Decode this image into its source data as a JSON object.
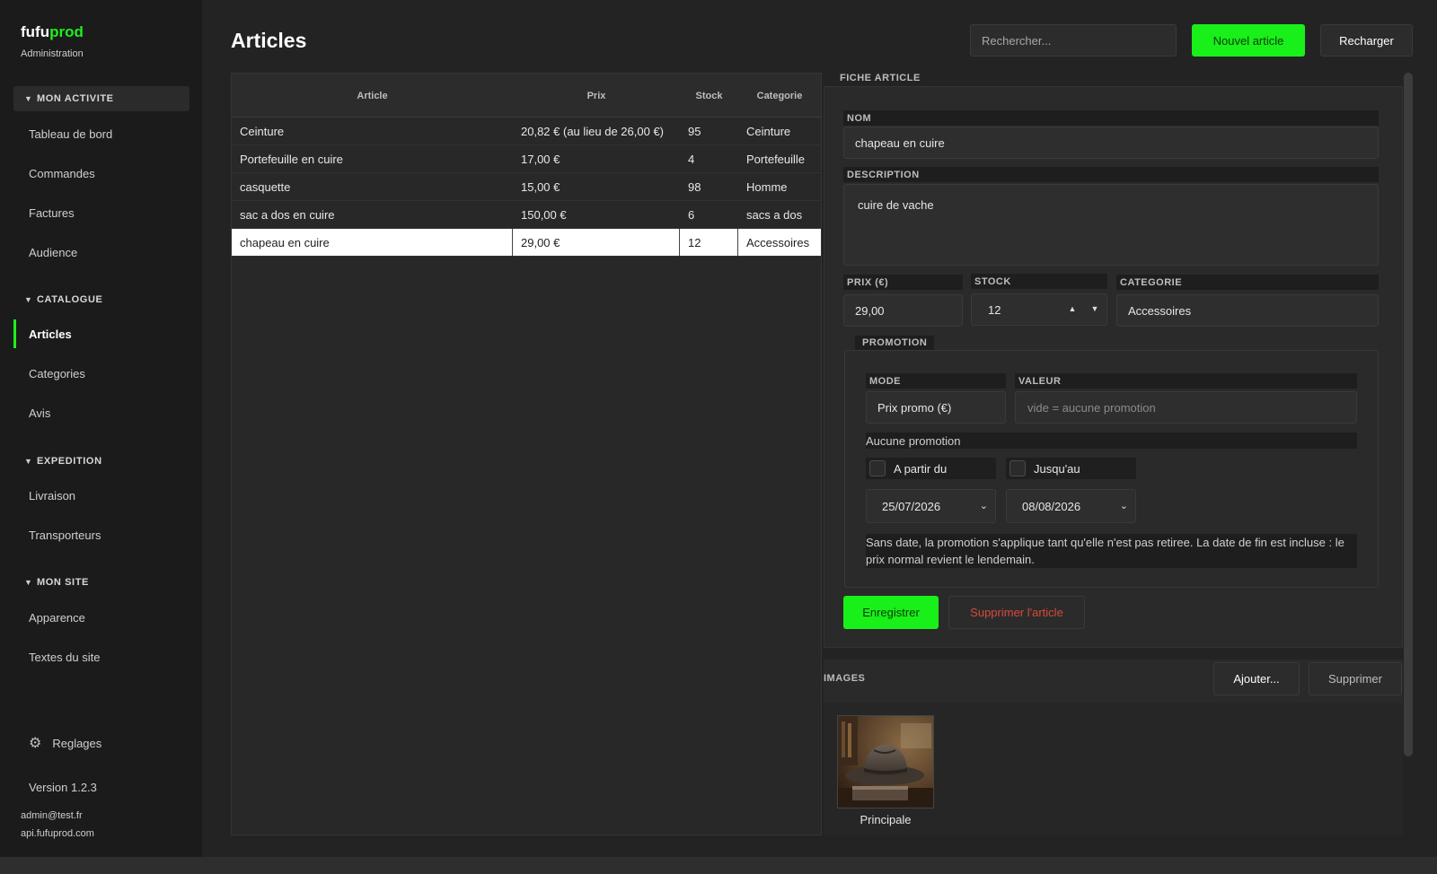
{
  "sidebar": {
    "brand_a": "fufu",
    "brand_b": "prod",
    "subtitle": "Administration",
    "sections": [
      {
        "title": "MON ACTIVITE",
        "items": [
          "Tableau de bord",
          "Commandes",
          "Factures",
          "Audience"
        ]
      },
      {
        "title": "CATALOGUE",
        "items": [
          "Articles",
          "Categories",
          "Avis"
        ]
      },
      {
        "title": "EXPEDITION",
        "items": [
          "Livraison",
          "Transporteurs"
        ]
      },
      {
        "title": "MON SITE",
        "items": [
          "Apparence",
          "Textes du site"
        ]
      }
    ],
    "settings_label": "Reglages",
    "version": "Version 1.2.3",
    "user_email": "admin@test.fr",
    "api_host": "api.fufuprod.com"
  },
  "header": {
    "title": "Articles",
    "search_placeholder": "Rechercher...",
    "new_button": "Nouvel article",
    "reload_button": "Recharger"
  },
  "table": {
    "columns": [
      "Article",
      "Prix",
      "Stock",
      "Categorie"
    ],
    "rows": [
      {
        "name": "Ceinture",
        "price": "20,82 €  (au lieu de 26,00 €)",
        "stock": "95",
        "category": "Ceinture"
      },
      {
        "name": "Portefeuille en cuire",
        "price": "17,00 €",
        "stock": "4",
        "category": "Portefeuille"
      },
      {
        "name": "casquette",
        "price": "15,00 €",
        "stock": "98",
        "category": "Homme"
      },
      {
        "name": "sac a dos en cuire",
        "price": "150,00 €",
        "stock": "6",
        "category": "sacs a dos"
      },
      {
        "name": "chapeau en cuire",
        "price": "29,00 €",
        "stock": "12",
        "category": "Accessoires"
      }
    ],
    "selected_index": 4
  },
  "detail": {
    "section_title": "FICHE ARTICLE",
    "name_label": "NOM",
    "name_value": "chapeau en cuire",
    "description_label": "DESCRIPTION",
    "description_value": "cuire de vache",
    "price_label": "PRIX (€)",
    "price_value": "29,00",
    "stock_label": "STOCK",
    "stock_value": "12",
    "category_label": "CATEGORIE",
    "category_value": "Accessoires",
    "promotion": {
      "title": "PROMOTION",
      "mode_label": "MODE",
      "mode_value": "Prix promo (€)",
      "value_label": "VALEUR",
      "value_placeholder": "vide = aucune promotion",
      "status": "Aucune promotion",
      "from_label": "A partir du",
      "until_label": "Jusqu'au",
      "from_date": "25/07/2026",
      "until_date": "08/08/2026",
      "help_text": "Sans date, la promotion s'applique tant qu'elle n'est pas retiree. La date de fin est incluse : le prix normal revient le lendemain."
    },
    "save_button": "Enregistrer",
    "delete_button": "Supprimer l'article"
  },
  "images": {
    "title": "IMAGES",
    "add_button": "Ajouter...",
    "remove_button": "Supprimer",
    "items": [
      {
        "caption": "Principale"
      }
    ]
  },
  "colors": {
    "accent": "#19ef19",
    "danger": "#d64a3a",
    "background": "#232323",
    "sidebar": "#1b1b1b"
  }
}
